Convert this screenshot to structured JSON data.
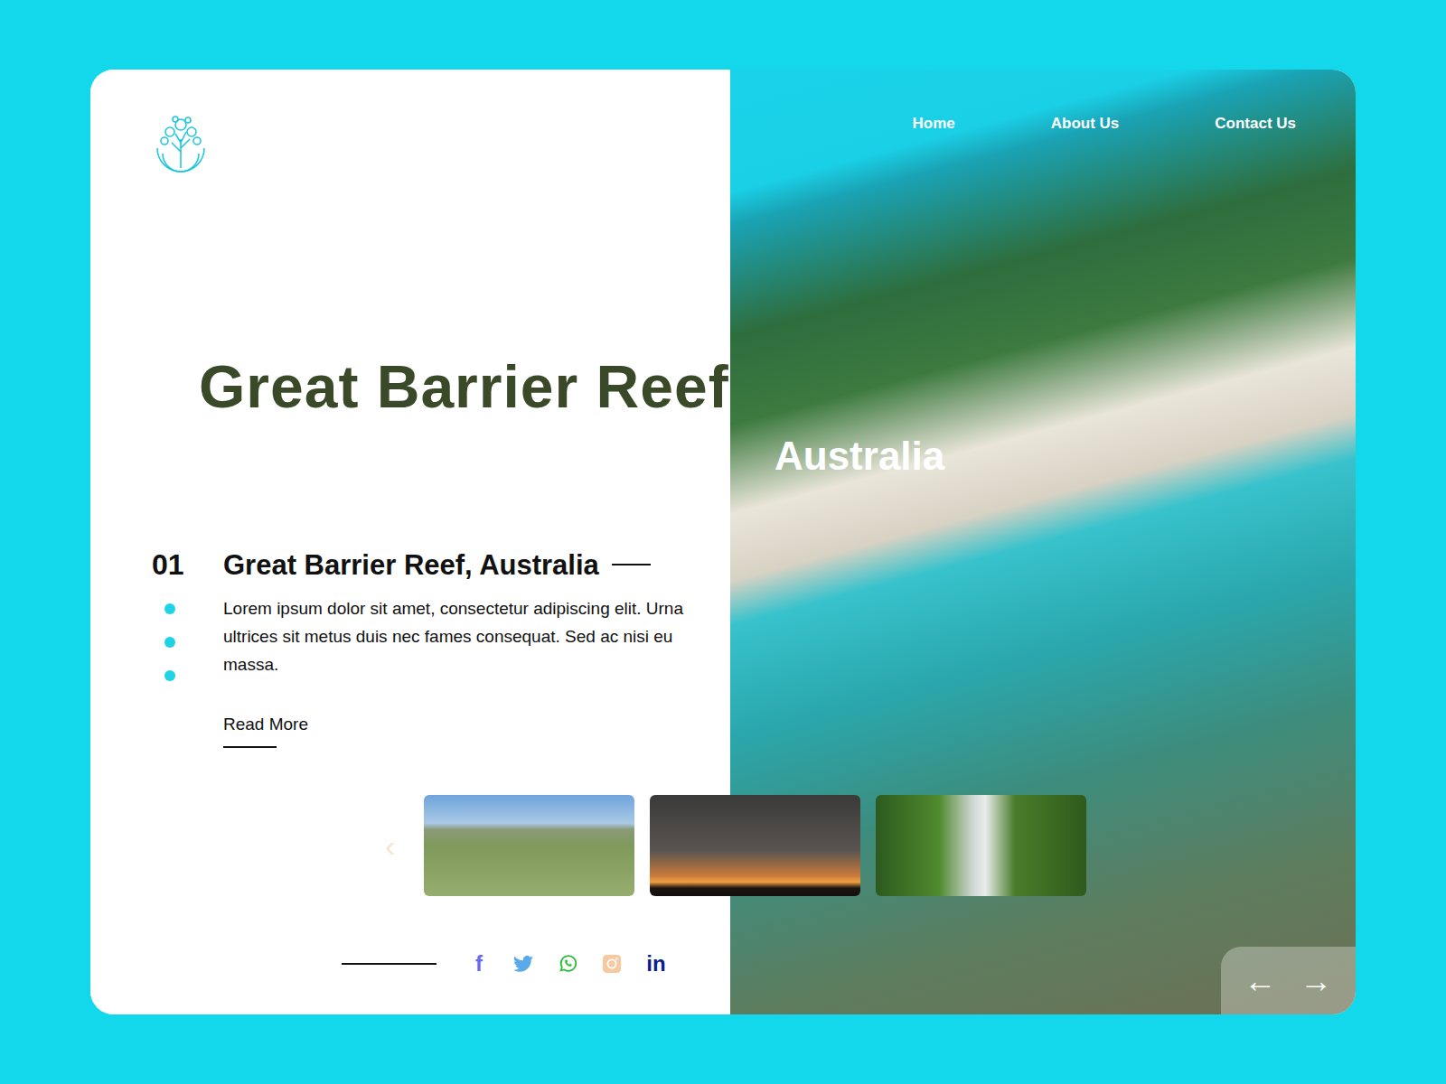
{
  "nav": [
    {
      "label": "Home"
    },
    {
      "label": "About Us"
    },
    {
      "label": "Contact Us"
    }
  ],
  "hero": {
    "title": "Great Barrier Reef",
    "subtitle": "Australia"
  },
  "slide": {
    "number": "01",
    "heading": "Great Barrier Reef, Australia",
    "body": "Lorem ipsum dolor sit amet, consectetur adipiscing elit. Urna ultrices sit metus duis nec fames consequat. Sed ac nisi eu massa.",
    "read_more": "Read More"
  },
  "gallery": {
    "prev": "‹",
    "thumbnails": [
      {
        "kind": "hills"
      },
      {
        "kind": "sunset"
      },
      {
        "kind": "waterfall"
      }
    ]
  },
  "socials": [
    {
      "kind": "glyph",
      "label": "f",
      "color": "#6a67e8"
    },
    {
      "kind": "twitter",
      "color": "#5aa9ea"
    },
    {
      "kind": "whatsapp",
      "color": "#2dbb3a"
    },
    {
      "kind": "instagram",
      "color": "#f7c9a0"
    },
    {
      "kind": "glyph",
      "label": "in",
      "color": "#0b1f8c"
    }
  ],
  "pager": {
    "prev": "←",
    "next": "→"
  }
}
